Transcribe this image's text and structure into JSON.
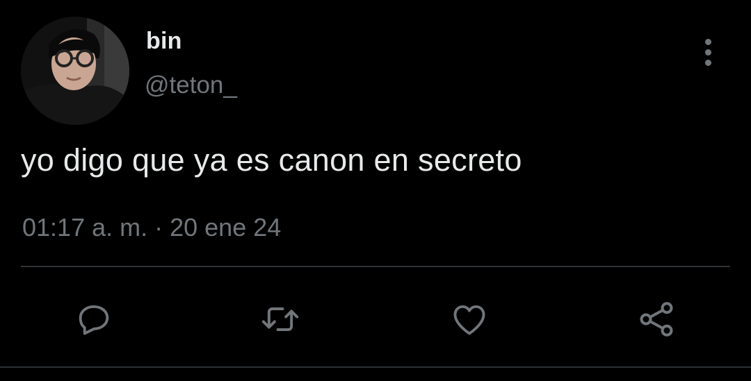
{
  "author": {
    "display_name": "bin",
    "handle": "@teton_"
  },
  "tweet": {
    "text": "yo digo que ya es canon en secreto",
    "time": "01:17 a. m.",
    "separator": "·",
    "date": "20 ene 24"
  },
  "icons": {
    "more": "more-vertical-icon",
    "reply": "reply-icon",
    "retweet": "retweet-icon",
    "like": "heart-icon",
    "share": "share-icon"
  },
  "colors": {
    "background": "#000000",
    "text_primary": "#e7e9ea",
    "text_secondary": "#71767b",
    "divider": "#2f3336"
  }
}
